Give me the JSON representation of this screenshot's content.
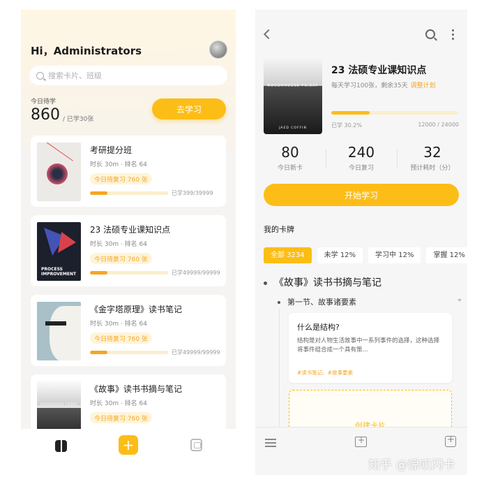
{
  "left": {
    "greeting": "Hi，Administrators",
    "search": {
      "placeholder": "搜索卡片、班级"
    },
    "today": {
      "label": "今日待学",
      "count": "860",
      "learned": "/ 已学30张"
    },
    "go_button": "去学习",
    "cards": [
      {
        "title": "考研提分班",
        "meta": "时长 30m · 排名 64",
        "badge": "今日待复习 760 张",
        "progress_label": "已学399/39999",
        "progress": 0.22
      },
      {
        "title": "23 法硕专业课知识点",
        "meta": "时长 30m · 排名 64",
        "badge": "今日待复习 760 张",
        "progress_label": "已学49999/99999",
        "progress": 0.22
      },
      {
        "title": "《金字塔原理》读书笔记",
        "meta": "时长 30m · 排名 64",
        "badge": "今日待复习 760 张",
        "progress_label": "已学49999/99999",
        "progress": 0.22
      },
      {
        "title": "《故事》读书书摘与笔记",
        "meta": "时长 30m · 排名 64",
        "badge": "今日待复习 760 张",
        "progress_label": "",
        "progress": 0.22
      }
    ],
    "cover_texts": {
      "process": "PROCESS IMPROVEMENT",
      "story": "ROUGHHOUSE FRIDAY"
    },
    "tabbar": {
      "add": "+"
    }
  },
  "right": {
    "book": {
      "title": "23 法硕专业课知识点",
      "sub": "每天学习100张，剩余35天",
      "adjust": "调整计划",
      "percent": "已学 30.2%",
      "count": "12000 / 24000",
      "progress": 0.302,
      "cover_title": "ROUGHHOUSE FRIDAY",
      "cover_author": "JAED COFFIN"
    },
    "stats": [
      {
        "num": "80",
        "label": "今日新卡"
      },
      {
        "num": "240",
        "label": "今日复习"
      },
      {
        "num": "32",
        "label": "预计耗时（分）"
      }
    ],
    "start_button": "开始学习",
    "my_deck": "我的卡牌",
    "filters": [
      "全部 3234",
      "未学 12%",
      "学习中 12%",
      "掌握 12%"
    ],
    "outline": {
      "level1": "《故事》读书书摘与笔记",
      "level2": "第一节、故事诸要素"
    },
    "qcard": {
      "question": "什么是结构?",
      "answer": "结构是对人物生活故事中一系列事件的选择，这种选择将事件组合成一个具有策...",
      "tags": "#读书笔记、#故事要素"
    },
    "create_label": "创建卡片"
  },
  "watermark": "知乎 @惊叹闪卡",
  "colors": {
    "accent": "#fcbd17",
    "accent_text": "#f5a623"
  }
}
